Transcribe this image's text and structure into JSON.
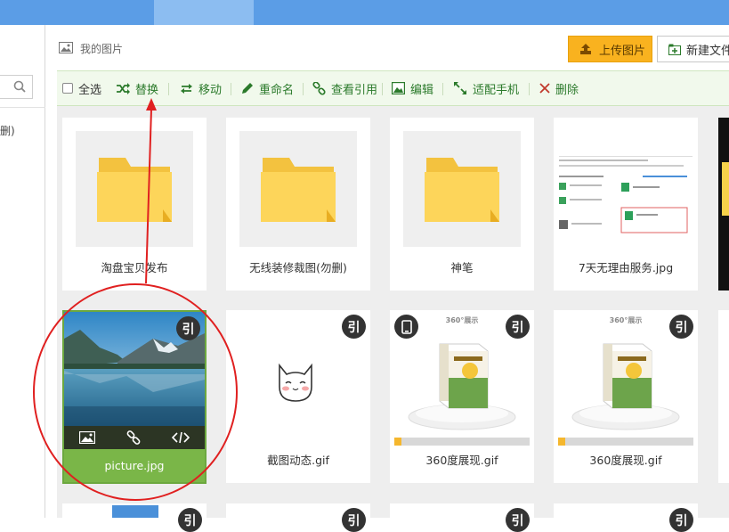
{
  "header": {
    "title": "我的图片",
    "upload_label": "上传图片",
    "new_folder_label": "新建文件"
  },
  "leftpane": {
    "partial_text": "删)"
  },
  "toolbar": {
    "select_all": "全选",
    "replace": "替换",
    "move": "移动",
    "rename": "重命名",
    "view_refs": "查看引用",
    "edit": "编辑",
    "fit_mobile": "适配手机",
    "delete": "删除"
  },
  "items": [
    {
      "name": "淘盘宝贝发布",
      "type": "folder"
    },
    {
      "name": "无线装修裁图(勿删)",
      "type": "folder"
    },
    {
      "name": "神笔",
      "type": "folder"
    },
    {
      "name": "7天无理由服务.jpg",
      "type": "image"
    },
    {
      "name": "picture.jpg",
      "type": "image",
      "selected": true,
      "badge": "引"
    },
    {
      "name": "截图动态.gif",
      "type": "image",
      "badge": "引"
    },
    {
      "name": "360度展现.gif",
      "type": "image",
      "badge": "引",
      "mobile": true,
      "caption": "360°展示"
    },
    {
      "name": "360度展现.gif",
      "type": "image",
      "badge": "引",
      "caption": "360°展示"
    }
  ],
  "badge_text": "引",
  "colors": {
    "accent_green": "#2b7a2b",
    "selected_green": "#7ab648",
    "upload_orange": "#f9b21f",
    "topbar_blue": "#5b9de6",
    "annotation_red": "#e02020"
  }
}
